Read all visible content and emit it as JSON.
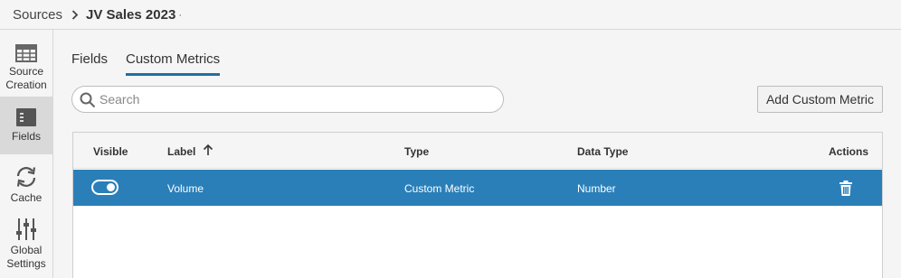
{
  "breadcrumb": {
    "parent": "Sources",
    "current": "JV Sales 2023",
    "suffix": "·"
  },
  "sidebar": {
    "items": [
      {
        "label_line1": "Source",
        "label_line2": "Creation",
        "icon": "table-icon",
        "active": false
      },
      {
        "label_line1": "Fields",
        "label_line2": "",
        "icon": "fields-icon",
        "active": true
      },
      {
        "label_line1": "Cache",
        "label_line2": "",
        "icon": "refresh-icon",
        "active": false
      },
      {
        "label_line1": "Global",
        "label_line2": "Settings",
        "icon": "sliders-icon",
        "active": false
      }
    ]
  },
  "tabs": [
    {
      "label": "Fields",
      "active": false
    },
    {
      "label": "Custom Metrics",
      "active": true
    }
  ],
  "search": {
    "placeholder": "Search",
    "value": ""
  },
  "toolbar": {
    "add_label": "Add Custom Metric"
  },
  "table": {
    "columns": {
      "visible": "Visible",
      "label": "Label",
      "type": "Type",
      "data_type": "Data Type",
      "actions": "Actions"
    },
    "sort": {
      "column": "label",
      "direction": "ascending"
    },
    "rows": [
      {
        "visible": true,
        "label": "Volume",
        "type": "Custom Metric",
        "data_type": "Number",
        "selected": true
      }
    ]
  },
  "colors": {
    "accent": "#1f6fa8",
    "selected_row": "#2a7fb9",
    "active_sidebar": "#d9d9d9"
  }
}
